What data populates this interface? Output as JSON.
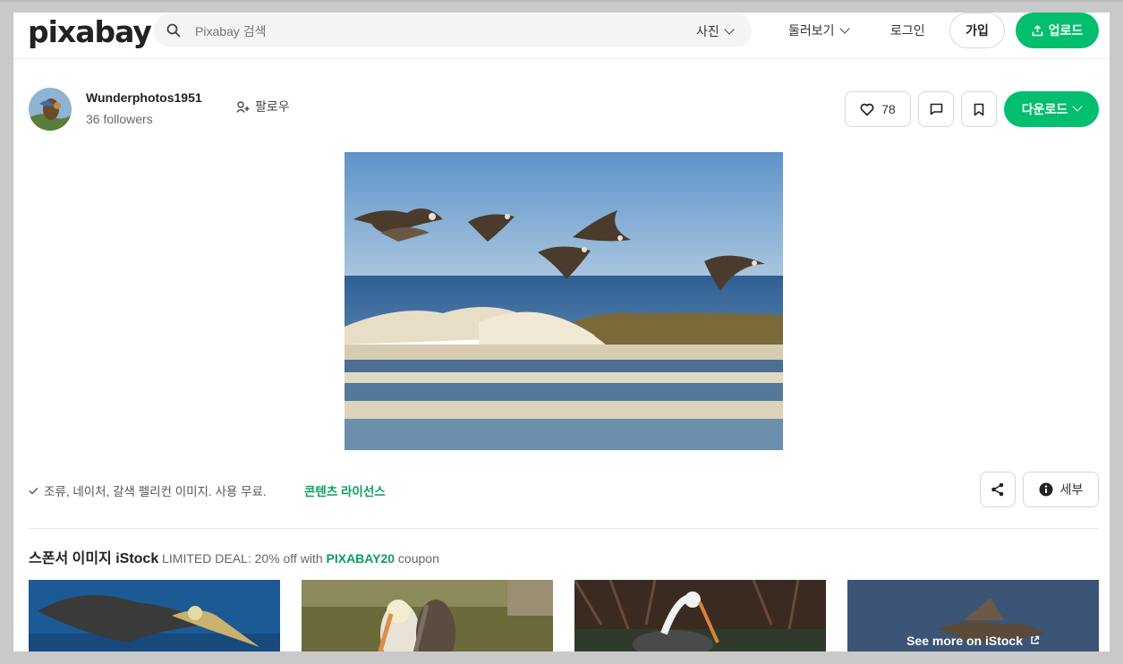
{
  "header": {
    "logo": "pixabay",
    "search_placeholder": "Pixabay 검색",
    "search_type": "사진",
    "explore": "둘러보기",
    "login": "로그인",
    "join": "가입",
    "upload": "업로드"
  },
  "user": {
    "name": "Wunderphotos1951",
    "followers": "36 followers",
    "follow": "팔로우"
  },
  "actions": {
    "likes": "78",
    "download": "다운로드"
  },
  "image_info": {
    "description": "조류, 네이처, 갈색 펠리컨 이미지. 사용 무료.",
    "license": "콘텐츠 라이선스",
    "details": "세부"
  },
  "sponsored": {
    "title": "스폰서 이미지 iStock",
    "deal_prefix": "LIMITED DEAL: 20% off with",
    "code": "PIXABAY20",
    "deal_suffix": "coupon",
    "see_more": "See more on iStock"
  },
  "colors": {
    "brand_green": "#02be6e",
    "link_green": "#0b9e5f"
  },
  "icons": [
    "search-icon",
    "chevron-down-icon",
    "upload-icon",
    "add-user-icon",
    "heart-icon",
    "comment-icon",
    "bookmark-icon",
    "share-icon",
    "info-icon",
    "check-icon",
    "external-link-icon"
  ]
}
